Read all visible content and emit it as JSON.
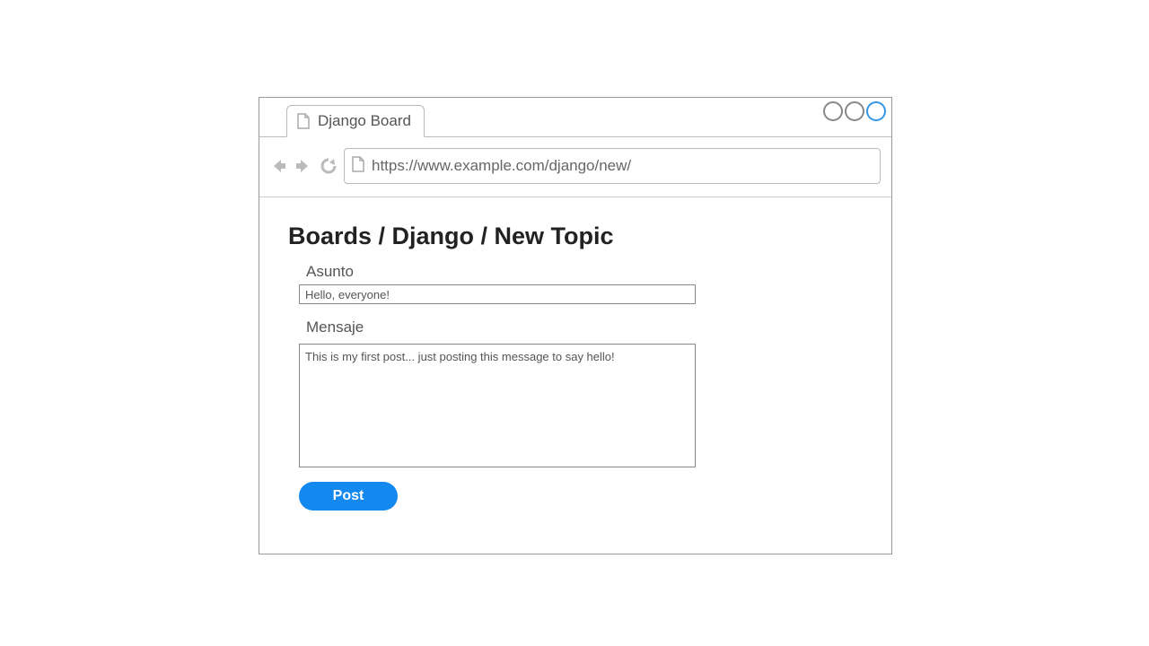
{
  "tab": {
    "title": "Django Board"
  },
  "address": {
    "url": "https://www.example.com/django/new/"
  },
  "page": {
    "breadcrumb": "Boards / Django / New Topic",
    "subject_label": "Asunto",
    "subject_value": "Hello, everyone!",
    "message_label": "Mensaje",
    "message_value": "This is my first post... just posting this message to say hello!",
    "post_button": "Post"
  }
}
